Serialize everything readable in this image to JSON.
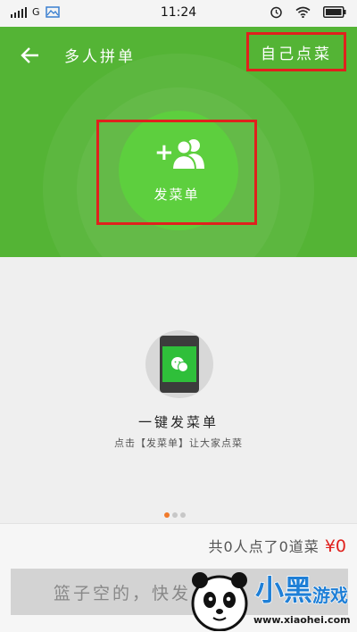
{
  "status_bar": {
    "network": "G",
    "time": "11:24"
  },
  "header": {
    "title": "多人拼单",
    "self_order_label": "自己点菜",
    "send_menu_label": "发菜单",
    "plus": "+",
    "bg_color": "#54b435"
  },
  "promo": {
    "title": "一键发菜单",
    "description": "点击【发菜单】让大家点菜"
  },
  "pager": {
    "count": 3,
    "active_index": 0,
    "active_color": "#f07a2b"
  },
  "footer": {
    "summary": "共0人点了0道菜",
    "price": "¥0",
    "basket_label": "篮子空的，快发",
    "price_color": "#e0211d"
  },
  "watermark": {
    "logo_text": "小黑游戏",
    "url": "www.xiaohei.com"
  },
  "icons": [
    "signal-icon",
    "image-icon",
    "alarm-icon",
    "wifi-icon",
    "battery-icon",
    "back-arrow-icon",
    "add-people-icon",
    "wechat-icon"
  ]
}
